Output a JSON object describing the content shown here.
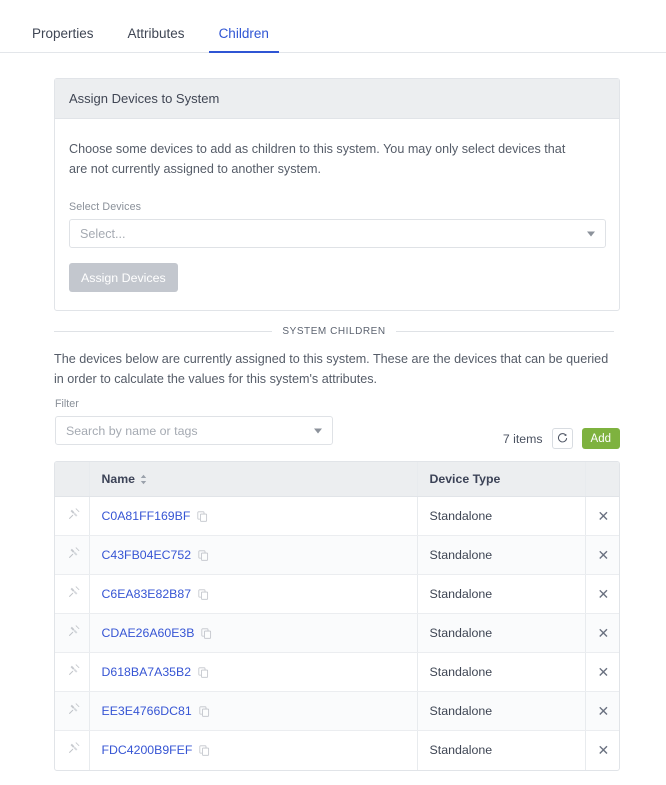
{
  "tabs": [
    {
      "label": "Properties",
      "active": false
    },
    {
      "label": "Attributes",
      "active": false
    },
    {
      "label": "Children",
      "active": true
    }
  ],
  "assign_card": {
    "title": "Assign Devices to System",
    "description": "Choose some devices to add as children to this system. You may only select devices that are not currently assigned to another system.",
    "select_label": "Select Devices",
    "select_placeholder": "Select...",
    "assign_button": "Assign Devices"
  },
  "divider": {
    "label": "SYSTEM CHILDREN"
  },
  "children_description": "The devices below are currently assigned to this system. These are the devices that can be queried in order to calculate the values for this system's attributes.",
  "filter": {
    "label": "Filter",
    "placeholder": "Search by name or tags"
  },
  "toolbar": {
    "item_count": "7 items",
    "refresh_icon": "refresh-icon",
    "add_button": "Add"
  },
  "table": {
    "columns": [
      "",
      "Name",
      "Device Type",
      ""
    ],
    "sort_icon": "sort-icon",
    "rows": [
      {
        "icon": "device-icon",
        "name": "C0A81FF169BF",
        "copy_icon": "copy-icon",
        "device_type": "Standalone",
        "remove_icon": "close-icon"
      },
      {
        "icon": "device-icon",
        "name": "C43FB04EC752",
        "copy_icon": "copy-icon",
        "device_type": "Standalone",
        "remove_icon": "close-icon"
      },
      {
        "icon": "device-icon",
        "name": "C6EA83E82B87",
        "copy_icon": "copy-icon",
        "device_type": "Standalone",
        "remove_icon": "close-icon"
      },
      {
        "icon": "device-icon",
        "name": "CDAE26A60E3B",
        "copy_icon": "copy-icon",
        "device_type": "Standalone",
        "remove_icon": "close-icon"
      },
      {
        "icon": "device-icon",
        "name": "D618BA7A35B2",
        "copy_icon": "copy-icon",
        "device_type": "Standalone",
        "remove_icon": "close-icon"
      },
      {
        "icon": "device-icon",
        "name": "EE3E4766DC81",
        "copy_icon": "copy-icon",
        "device_type": "Standalone",
        "remove_icon": "close-icon"
      },
      {
        "icon": "device-icon",
        "name": "FDC4200B9FEF",
        "copy_icon": "copy-icon",
        "device_type": "Standalone",
        "remove_icon": "close-icon"
      }
    ]
  },
  "colors": {
    "accent_blue": "#2f55d4",
    "link_blue": "#3655d4",
    "add_green": "#7eb23f",
    "header_gray": "#eceef0",
    "border_gray": "#e1e4e8",
    "disabled_gray": "#b9bec6"
  }
}
